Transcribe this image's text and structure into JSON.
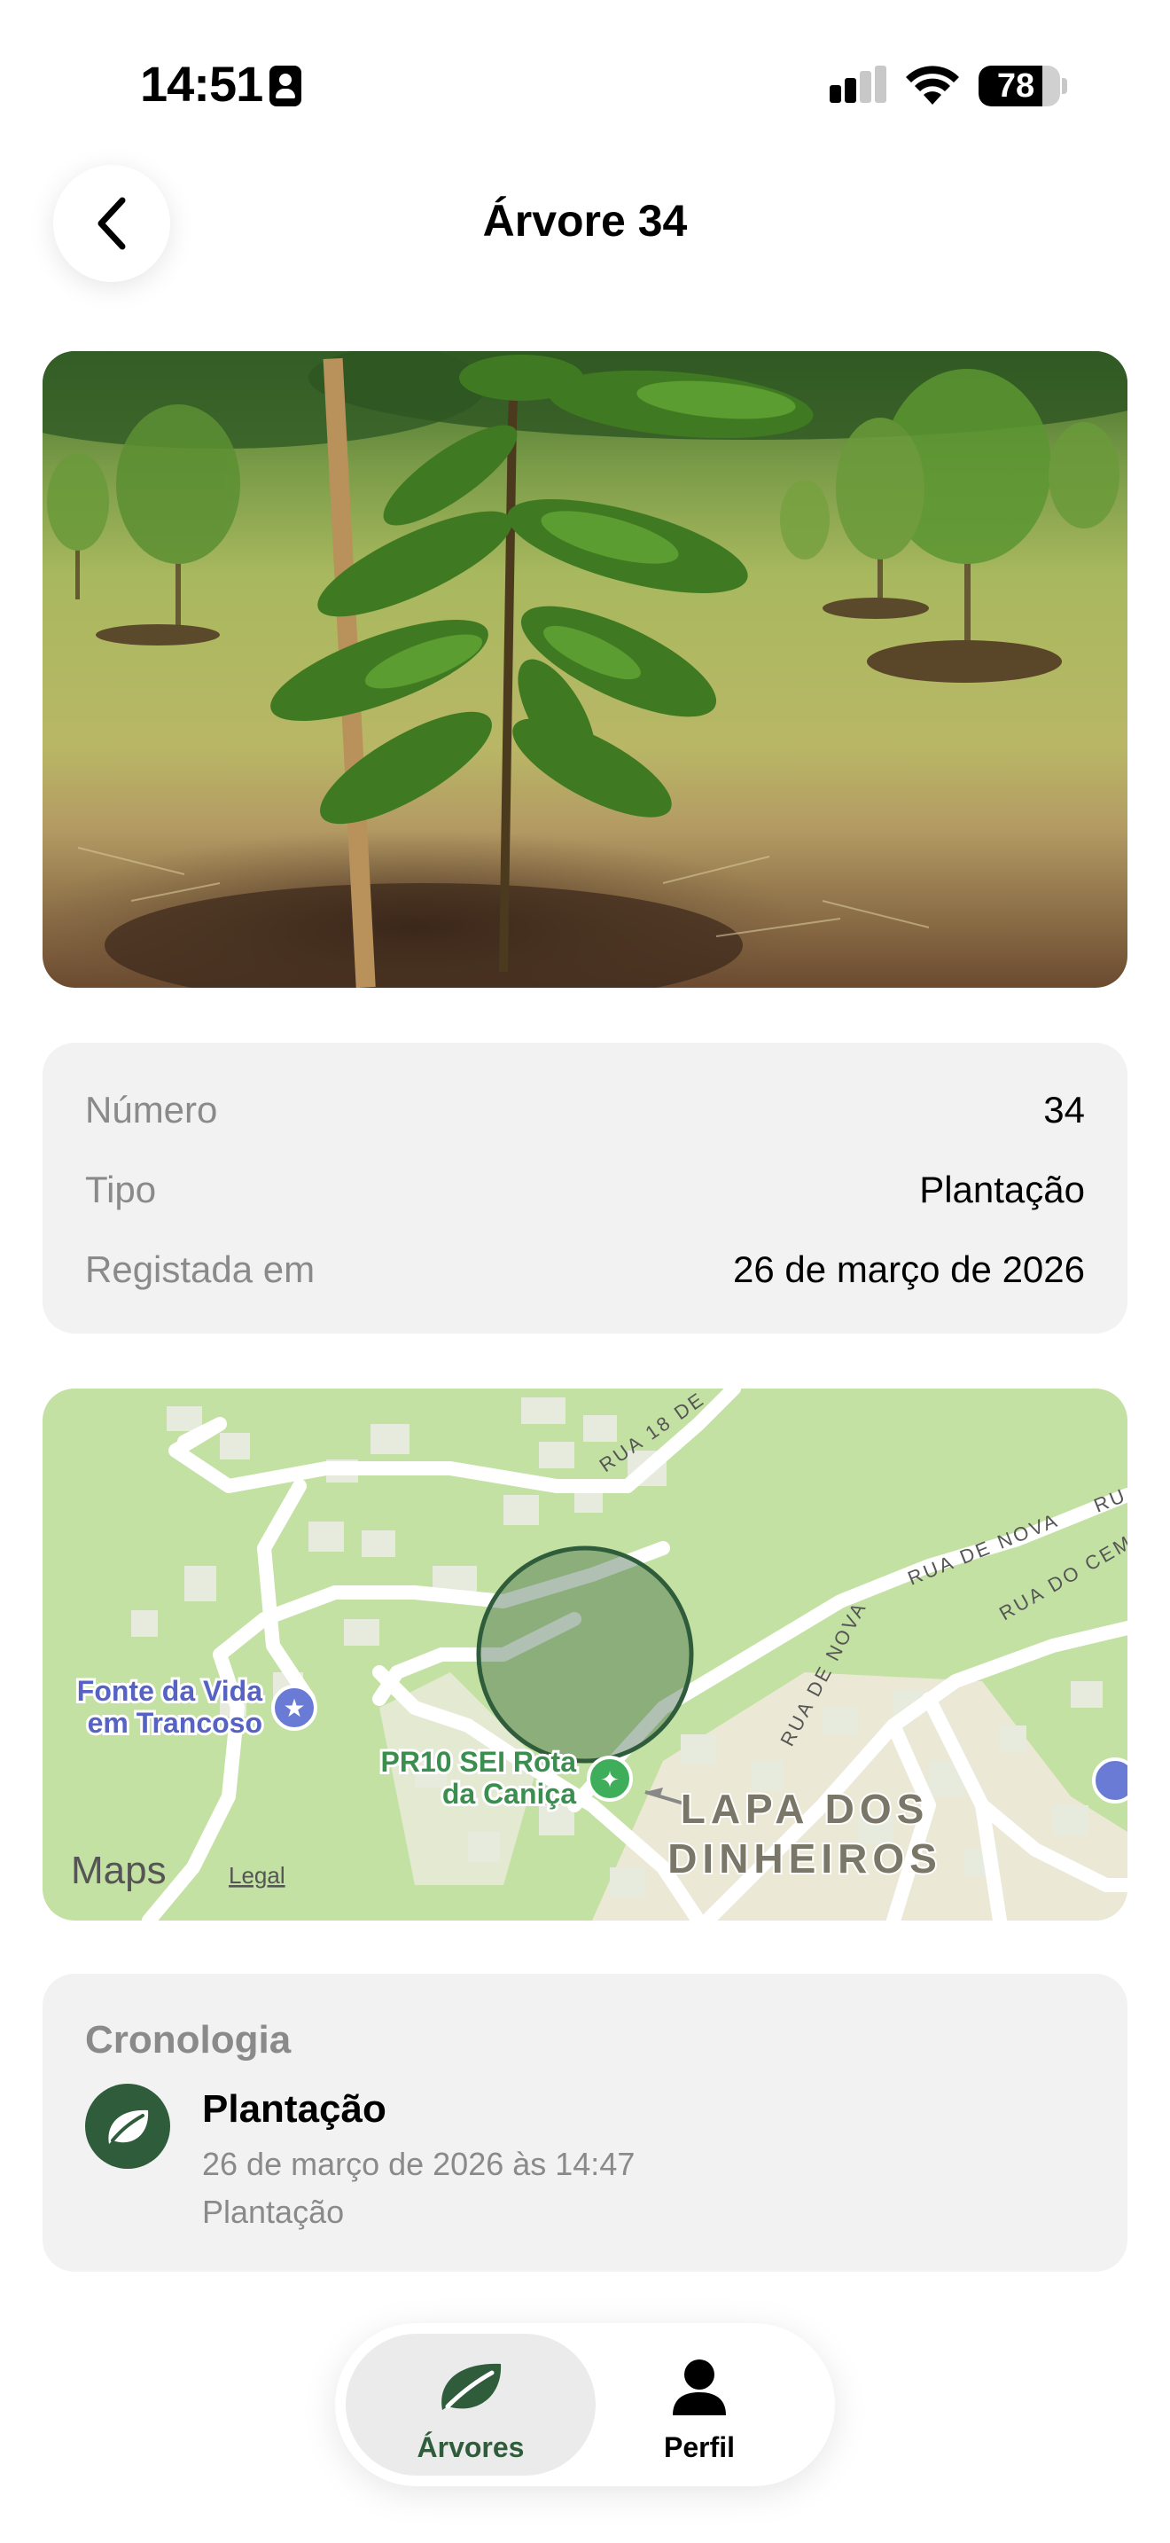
{
  "status_bar": {
    "time": "14:51",
    "battery": "78",
    "battery_level": 0.78
  },
  "header": {
    "title": "Árvore 34"
  },
  "details": {
    "rows": [
      {
        "label": "Número",
        "value": "34"
      },
      {
        "label": "Tipo",
        "value": "Plantação"
      },
      {
        "label": "Registada em",
        "value": "26 de março de 2026"
      }
    ]
  },
  "map": {
    "poi_fonte_line1": "Fonte da Vida",
    "poi_fonte_line2": "em Trancoso",
    "poi_pr10_line1": "PR10 SEI Rota",
    "poi_pr10_line2": "da Caniça",
    "area_line1": "LAPA DOS",
    "area_line2": "DINHEIROS",
    "street_rua18": "RUA 18 DE",
    "street_nova1": "RUA DE NOVA",
    "street_nova2": "RUA DE NOVA",
    "street_cemiterio": "RUA DO CEM",
    "street_ru": "RU",
    "brand": "Maps",
    "legal": "Legal"
  },
  "timeline": {
    "heading": "Cronologia",
    "items": [
      {
        "title": "Plantação",
        "date": "26 de março de 2026 às 14:47",
        "description": "Plantação",
        "icon": "leaf-icon"
      }
    ]
  },
  "tab_bar": {
    "tabs": [
      {
        "label": "Árvores",
        "icon": "leaf-icon",
        "active": true
      },
      {
        "label": "Perfil",
        "icon": "person-icon",
        "active": false
      }
    ]
  },
  "colors": {
    "accent_green": "#2f5d3b",
    "map_green": "#c3e1a2",
    "card_bg": "#f2f2f2"
  }
}
